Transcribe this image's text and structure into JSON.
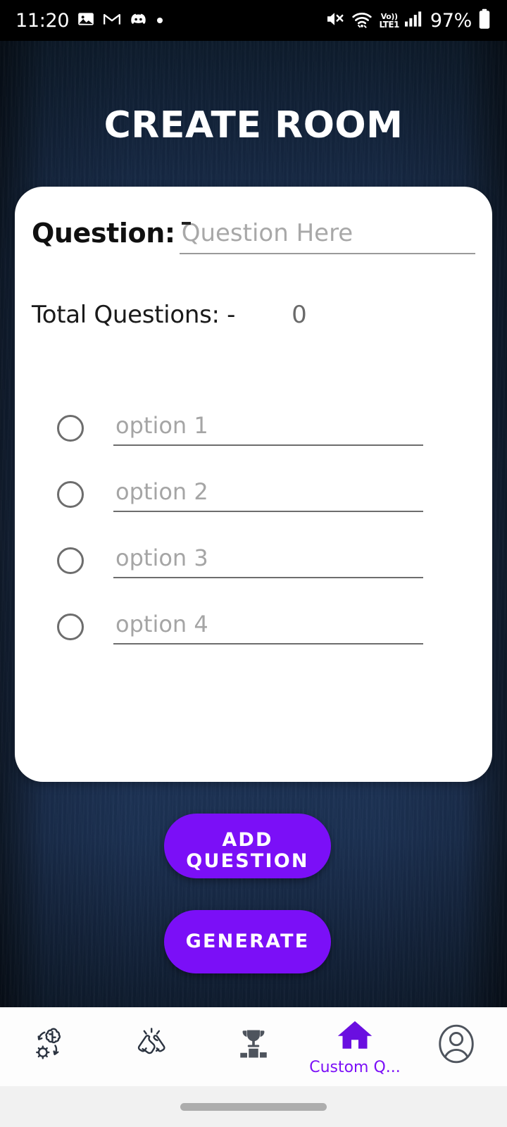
{
  "status_bar": {
    "time": "11:20",
    "battery_percent": "97%",
    "volte_top": "Vo))",
    "volte_bottom": "LTE1",
    "icons": [
      "photos-icon",
      "gmail-icon",
      "discord-icon",
      "dot-icon",
      "mute-icon",
      "wifi-icon",
      "volte-icon",
      "signal-icon",
      "battery-icon"
    ]
  },
  "header": {
    "title": "CREATE ROOM"
  },
  "card": {
    "question_label": "Question:",
    "question_value": "",
    "question_placeholder": "Question Here",
    "total_questions_label": "Total Questions: -",
    "total_questions_count": "0",
    "options": [
      {
        "value": "",
        "placeholder": "option 1",
        "selected": false
      },
      {
        "value": "",
        "placeholder": "option 2",
        "selected": false
      },
      {
        "value": "",
        "placeholder": "option 3",
        "selected": false
      },
      {
        "value": "",
        "placeholder": "option 4",
        "selected": false
      }
    ]
  },
  "actions": {
    "add_question_label": "ADD\nQUESTION",
    "add_question_line1": "ADD",
    "add_question_line2": "QUESTION",
    "generate_label": "GENERATE"
  },
  "bottom_nav": {
    "items": [
      {
        "icon": "brain-gear-icon",
        "label": ""
      },
      {
        "icon": "handshake-icon",
        "label": ""
      },
      {
        "icon": "trophy-podium-icon",
        "label": ""
      },
      {
        "icon": "home-icon",
        "label": "Custom Q...",
        "active": true
      },
      {
        "icon": "profile-icon",
        "label": ""
      }
    ]
  },
  "colors": {
    "accent_purple": "#7B0FF7",
    "background_navy": "#1b3152",
    "card_white": "#ffffff",
    "status_bar_black": "#000000"
  }
}
